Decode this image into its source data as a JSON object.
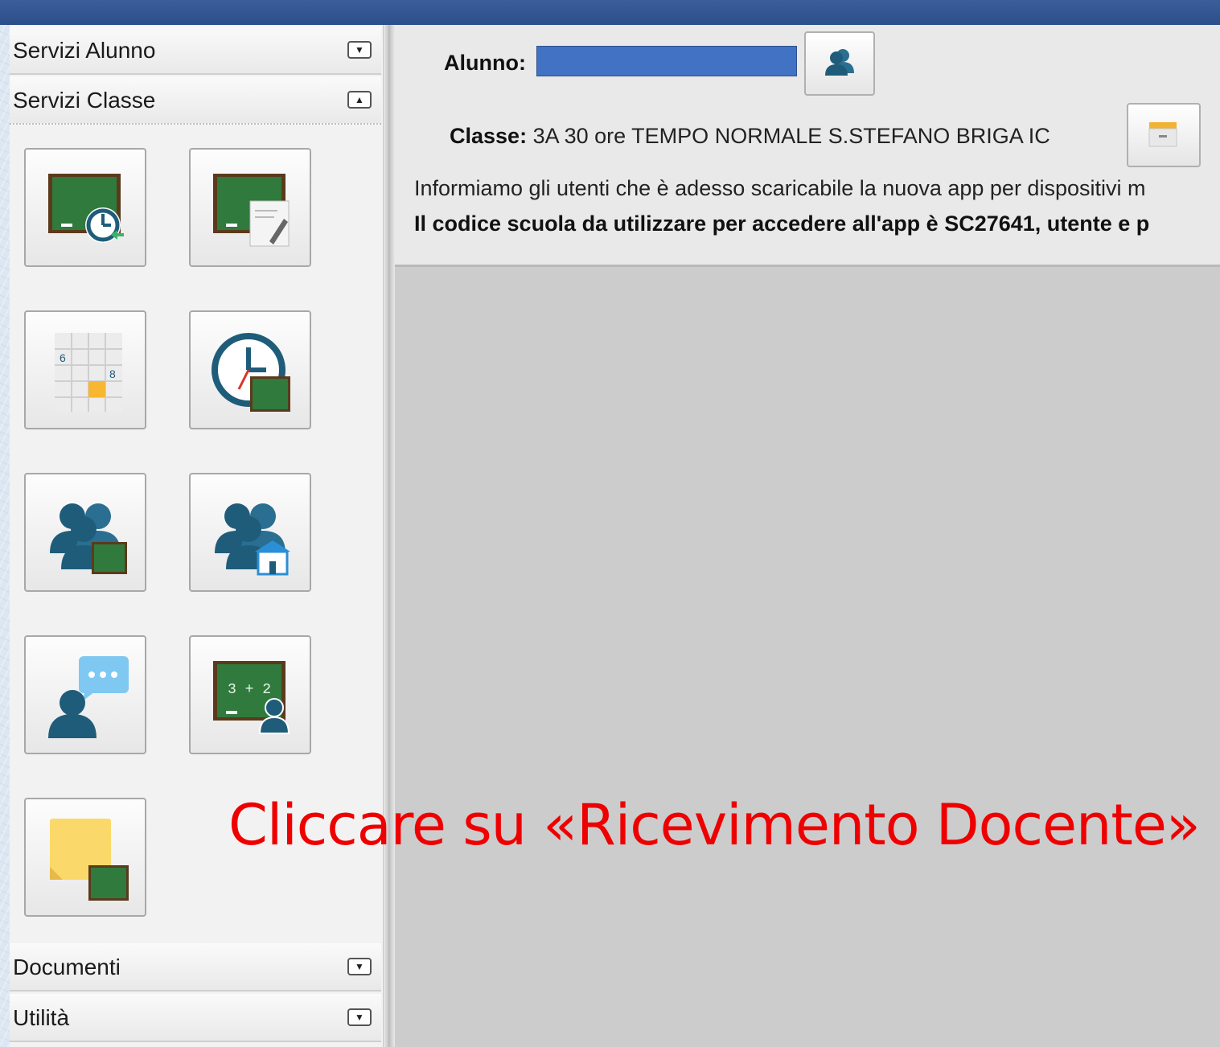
{
  "sidebar": {
    "sections": [
      {
        "label": "Servizi Alunno",
        "state": "collapsed"
      },
      {
        "label": "Servizi Classe",
        "state": "expanded"
      },
      {
        "label": "Documenti",
        "state": "collapsed"
      },
      {
        "label": "Utilità",
        "state": "collapsed"
      }
    ],
    "tiles": [
      {
        "icon": "blackboard-clock-icon"
      },
      {
        "icon": "blackboard-edit-icon"
      },
      {
        "icon": "calendar-grid-icon",
        "num1": "6",
        "num2": "8"
      },
      {
        "icon": "clock-blackboard-icon"
      },
      {
        "icon": "group-blackboard-icon"
      },
      {
        "icon": "group-school-icon"
      },
      {
        "icon": "teacher-chat-icon"
      },
      {
        "icon": "blackboard-person-icon",
        "formula": "3 + 2"
      },
      {
        "icon": "sticky-note-blackboard-icon"
      }
    ]
  },
  "main": {
    "alunno_label": "Alunno:",
    "classe_label": "Classe:",
    "classe_value": "3A 30 ore TEMPO NORMALE S.STEFANO BRIGA IC",
    "info_line1": "Informiamo gli utenti che è adesso scaricabile la nuova app per dispositivi m",
    "info_line2": "Il codice scuola da utilizzare per accedere all'app è SC27641, utente e p"
  },
  "overlay_text": "Cliccare su «Ricevimento Docente»",
  "colors": {
    "accent_blue": "#4272c4",
    "icon_teal": "#1f5c7a",
    "board_green": "#2f7a3c",
    "overlay_red": "#ee0000"
  }
}
